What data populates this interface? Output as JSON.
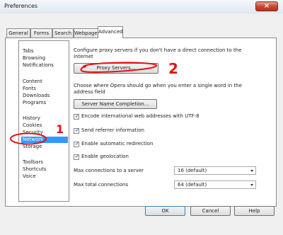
{
  "window": {
    "title": "Preferences",
    "close_label": "×"
  },
  "tabs": [
    "General",
    "Forms",
    "Search",
    "Webpages",
    "Advanced"
  ],
  "categories": {
    "group1": [
      "Tabs",
      "Browsing",
      "Notifications"
    ],
    "group2": [
      "Content",
      "Fonts",
      "Downloads",
      "Programs"
    ],
    "group3": [
      "History",
      "Cookies",
      "Security",
      "Network",
      "Storage"
    ],
    "group4": [
      "Toolbars",
      "Shortcuts",
      "Voice"
    ],
    "selected": "Network"
  },
  "network": {
    "proxy_desc": "Configure proxy servers if you don't have a direct connection to the Internet",
    "proxy_desc_line1": "Configure proxy servers if you don't have a direct connection to the",
    "proxy_desc_line2": "Internet",
    "proxy_button": "Proxy Servers...",
    "completion_desc_line1": "Choose where Opera should go when you enter a single word in the",
    "completion_desc_line2": "address field",
    "completion_button": "Server Name Completion...",
    "checkboxes": [
      {
        "label": "Encode international web addresses with UTF-8",
        "checked": true
      },
      {
        "label": "Send referrer information",
        "checked": true
      },
      {
        "label": "Enable automatic redirection",
        "checked": true
      },
      {
        "label": "Enable geolocation",
        "checked": true
      }
    ],
    "max_server_label": "Max connections to a server",
    "max_server_value": "16 (default)",
    "max_total_label": "Max total connections",
    "max_total_value": "64 (default)"
  },
  "footer": {
    "ok": "OK",
    "cancel": "Cancel",
    "help": "Help"
  },
  "annotations": {
    "one": "1",
    "two": "2",
    "color": "#e01414"
  }
}
